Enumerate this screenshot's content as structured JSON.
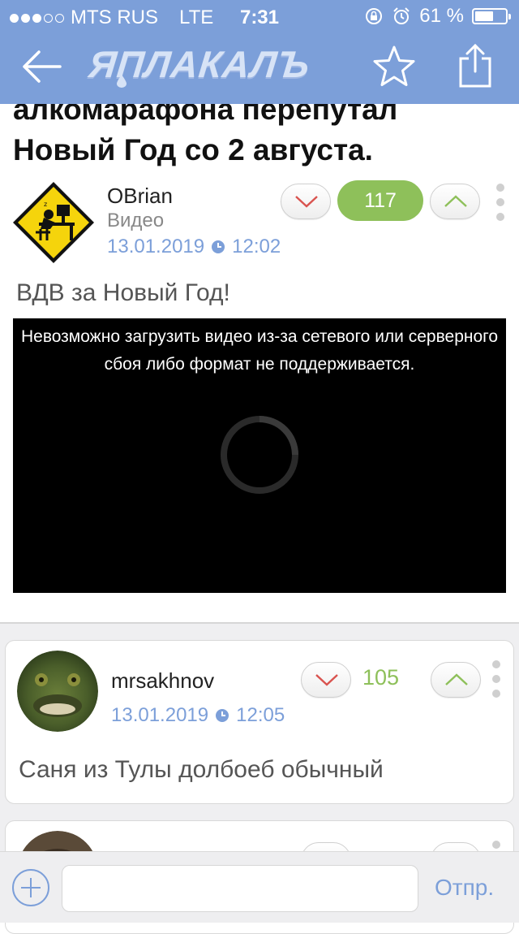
{
  "status_bar": {
    "carrier": "MTS RUS",
    "network": "LTE",
    "time": "7:31",
    "battery_text": "61 %",
    "battery_level": 0.61,
    "signal_bars_filled": 3,
    "signal_bars_total": 5
  },
  "nav": {
    "logo": "ЯПЛАКАЛЪ",
    "back_icon": "arrow-left-icon",
    "star_icon": "star-icon",
    "share_icon": "share-icon"
  },
  "post": {
    "title": "алкомарафона перепутал Новый Год со 2 августа.",
    "author": "OBrian",
    "category": "Видео",
    "date": "13.01.2019",
    "time": "12:02",
    "score": "117",
    "text": "ВДВ за Новый Год!",
    "video_error": "Невозможно загрузить видео из-за сетевого или серверного сбоя либо формат не поддерживается."
  },
  "comments": [
    {
      "author": "mrsakhnov",
      "date": "13.01.2019",
      "time": "12:05",
      "score": "105",
      "text": "Саня из Тулы долбоеб обычный"
    }
  ],
  "input_bar": {
    "placeholder": "",
    "send_label": "Отпр."
  },
  "colors": {
    "accent": "#7c9fd9",
    "score_green": "#8ec05a",
    "downvote_red": "#d9534f"
  }
}
